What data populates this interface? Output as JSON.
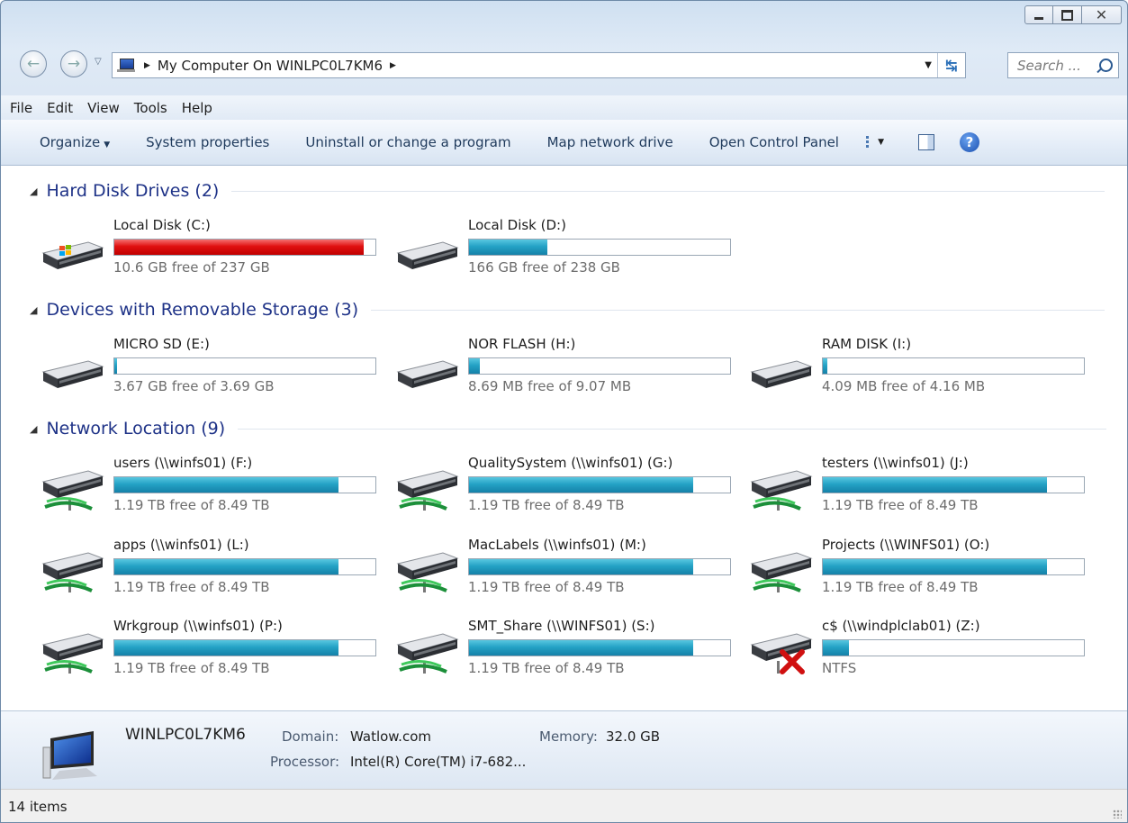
{
  "address": {
    "breadcrumb": "My Computer On WINLPC0L7KM6",
    "search_placeholder": "Search ..."
  },
  "menu": [
    "File",
    "Edit",
    "View",
    "Tools",
    "Help"
  ],
  "commands": {
    "organize": "Organize",
    "system_properties": "System properties",
    "uninstall": "Uninstall or change a program",
    "map_drive": "Map network drive",
    "control_panel": "Open Control Panel"
  },
  "groups": [
    {
      "title": "Hard Disk Drives (2)",
      "drives": [
        {
          "name": "Local Disk (C:)",
          "free": "10.6 GB free of 237 GB",
          "used_fraction": 0.955,
          "state": "full",
          "icon": "windows-drive-icon"
        },
        {
          "name": "Local Disk (D:)",
          "free": "166 GB free of 238 GB",
          "used_fraction": 0.3,
          "state": "normal",
          "icon": "hard-drive-icon"
        }
      ]
    },
    {
      "title": "Devices with Removable Storage (3)",
      "drives": [
        {
          "name": "MICRO SD (E:)",
          "free": "3.67 GB free of 3.69 GB",
          "used_fraction": 0.006,
          "state": "normal",
          "icon": "hard-drive-icon"
        },
        {
          "name": "NOR FLASH (H:)",
          "free": "8.69 MB free of 9.07 MB",
          "used_fraction": 0.04,
          "state": "normal",
          "icon": "hard-drive-icon"
        },
        {
          "name": "RAM DISK (I:)",
          "free": "4.09 MB free of 4.16 MB",
          "used_fraction": 0.017,
          "state": "normal",
          "icon": "hard-drive-icon"
        }
      ]
    },
    {
      "title": "Network Location (9)",
      "drives": [
        {
          "name": "users (\\\\winfs01) (F:)",
          "free": "1.19 TB free of 8.49 TB",
          "used_fraction": 0.86,
          "state": "normal",
          "icon": "network-drive-icon"
        },
        {
          "name": "QualitySystem (\\\\winfs01) (G:)",
          "free": "1.19 TB free of 8.49 TB",
          "used_fraction": 0.86,
          "state": "normal",
          "icon": "network-drive-icon"
        },
        {
          "name": "testers (\\\\winfs01) (J:)",
          "free": "1.19 TB free of 8.49 TB",
          "used_fraction": 0.86,
          "state": "normal",
          "icon": "network-drive-icon"
        },
        {
          "name": "apps (\\\\winfs01) (L:)",
          "free": "1.19 TB free of 8.49 TB",
          "used_fraction": 0.86,
          "state": "normal",
          "icon": "network-drive-icon"
        },
        {
          "name": "MacLabels (\\\\winfs01) (M:)",
          "free": "1.19 TB free of 8.49 TB",
          "used_fraction": 0.86,
          "state": "normal",
          "icon": "network-drive-icon"
        },
        {
          "name": "Projects (\\\\WINFS01) (O:)",
          "free": "1.19 TB free of 8.49 TB",
          "used_fraction": 0.86,
          "state": "normal",
          "icon": "network-drive-icon"
        },
        {
          "name": "Wrkgroup (\\\\winfs01) (P:)",
          "free": "1.19 TB free of 8.49 TB",
          "used_fraction": 0.86,
          "state": "normal",
          "icon": "network-drive-icon"
        },
        {
          "name": "SMT_Share (\\\\WINFS01) (S:)",
          "free": "1.19 TB free of 8.49 TB",
          "used_fraction": 0.86,
          "state": "normal",
          "icon": "network-drive-icon"
        },
        {
          "name": "c$ (\\\\windplclab01) (Z:)",
          "free": "NTFS",
          "used_fraction": 0.1,
          "state": "disconnected",
          "icon": "disconnected-network-drive-icon"
        }
      ]
    }
  ],
  "details": {
    "computer_name": "WINLPC0L7KM6",
    "domain_label": "Domain:",
    "domain_value": "Watlow.com",
    "memory_label": "Memory:",
    "memory_value": "32.0 GB",
    "processor_label": "Processor:",
    "processor_value": "Intel(R) Core(TM) i7-682..."
  },
  "status": {
    "items": "14 items"
  },
  "colors": {
    "accent": "#1e3287",
    "bar_normal": "#26a0c4",
    "bar_full": "#e01010"
  }
}
